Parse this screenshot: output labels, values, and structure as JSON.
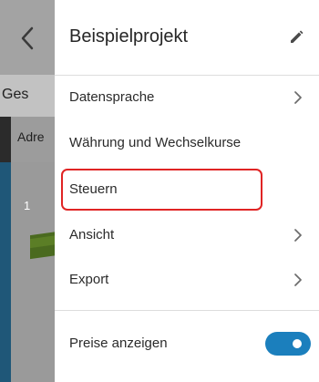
{
  "background": {
    "section_title": "Ges",
    "row_label": "Adre",
    "item_number": "1"
  },
  "menu": {
    "title": "Beispielprojekt",
    "items": [
      {
        "label": "Datensprache",
        "has_submenu": true
      },
      {
        "label": "Währung und Wechselkurse",
        "has_submenu": false
      },
      {
        "label": "Steuern",
        "has_submenu": false,
        "highlighted": true
      },
      {
        "label": "Ansicht",
        "has_submenu": true
      },
      {
        "label": "Export",
        "has_submenu": true
      }
    ],
    "toggle": {
      "label": "Preise anzeigen",
      "enabled": true
    }
  },
  "colors": {
    "accent": "#1b7fbd",
    "highlight_border": "#e02424"
  },
  "icons": [
    "back-icon",
    "edit-icon",
    "chevron-right-icon"
  ]
}
